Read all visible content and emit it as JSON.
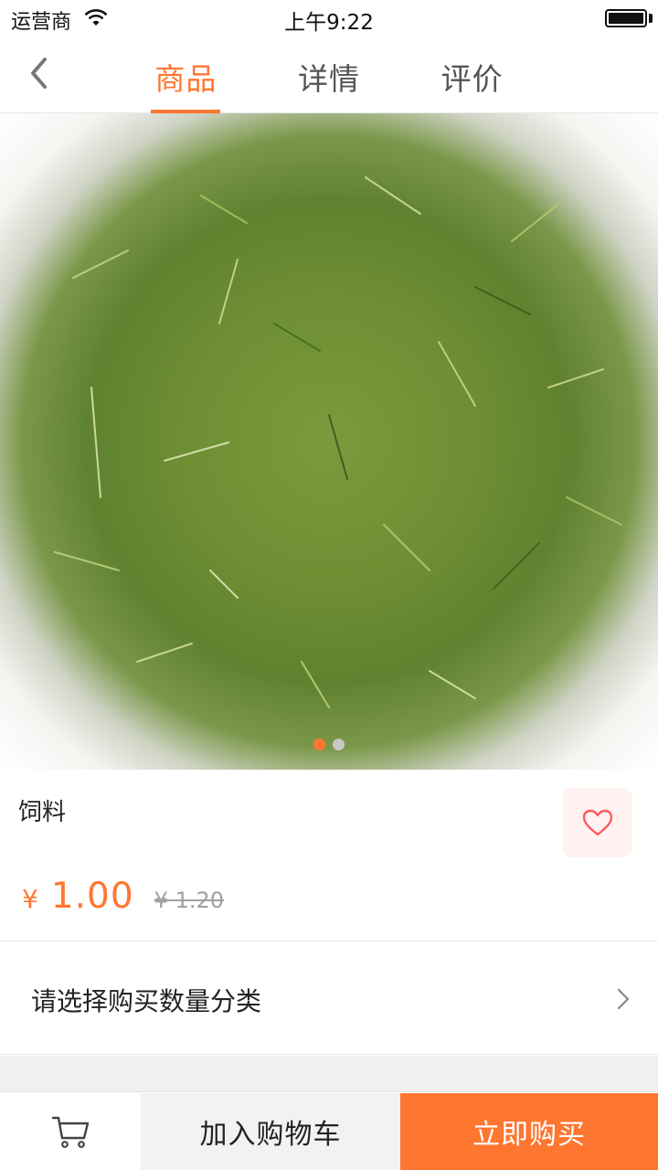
{
  "status_bar": {
    "carrier": "运营商",
    "time": "上午9:22"
  },
  "nav": {
    "tabs": [
      {
        "label": "商品",
        "active": true
      },
      {
        "label": "详情",
        "active": false
      },
      {
        "label": "评价",
        "active": false
      }
    ]
  },
  "carousel": {
    "slide_count": 2,
    "current_slide": 1
  },
  "product": {
    "name": "饲料",
    "currency_symbol": "¥",
    "price": "1.00",
    "original_price": "¥ 1.20"
  },
  "spec": {
    "label": "请选择购买数量分类"
  },
  "bottom_bar": {
    "add_to_cart": "加入购物车",
    "buy_now": "立即购买"
  },
  "colors": {
    "accent": "#ff7630",
    "favorite_bg": "#fff2f0"
  },
  "icons": {
    "back": "chevron-left-icon",
    "favorite": "heart-icon",
    "spec": "chevron-right-icon",
    "cart": "cart-icon"
  }
}
